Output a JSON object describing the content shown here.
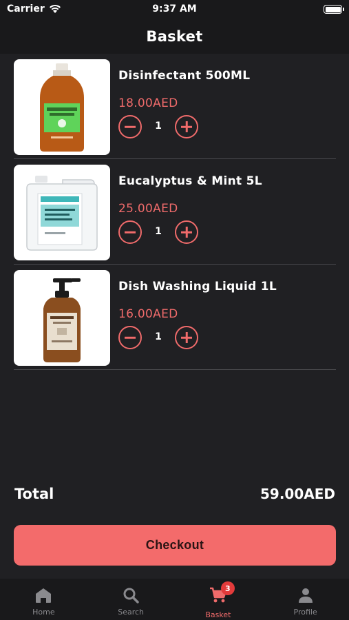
{
  "status_bar": {
    "carrier": "Carrier",
    "time": "9:37 AM"
  },
  "header": {
    "title": "Basket"
  },
  "basket": {
    "items": [
      {
        "name": "Disinfectant 500ML",
        "price": "18.00AED",
        "quantity": "1",
        "image_icon": "brown-disinfectant-bottle"
      },
      {
        "name": "Eucalyptus & Mint 5L",
        "price": "25.00AED",
        "quantity": "1",
        "image_icon": "white-jerrycan"
      },
      {
        "name": "Dish Washing Liquid 1L",
        "price": "16.00AED",
        "quantity": "1",
        "image_icon": "amber-pump-bottle"
      }
    ]
  },
  "summary": {
    "total_label": "Total",
    "total_value": "59.00AED"
  },
  "checkout": {
    "label": "Checkout"
  },
  "tab_bar": {
    "items": [
      {
        "label": "Home",
        "icon": "home-icon"
      },
      {
        "label": "Search",
        "icon": "search-icon"
      },
      {
        "label": "Basket",
        "icon": "cart-icon",
        "badge": "3",
        "active": true
      },
      {
        "label": "Profile",
        "icon": "person-icon"
      }
    ]
  },
  "colors": {
    "accent": "#f06b6b",
    "background": "#202023",
    "bar_background": "#19191b",
    "checkout_button": "#f36b6b",
    "badge": "#e33b3b"
  }
}
